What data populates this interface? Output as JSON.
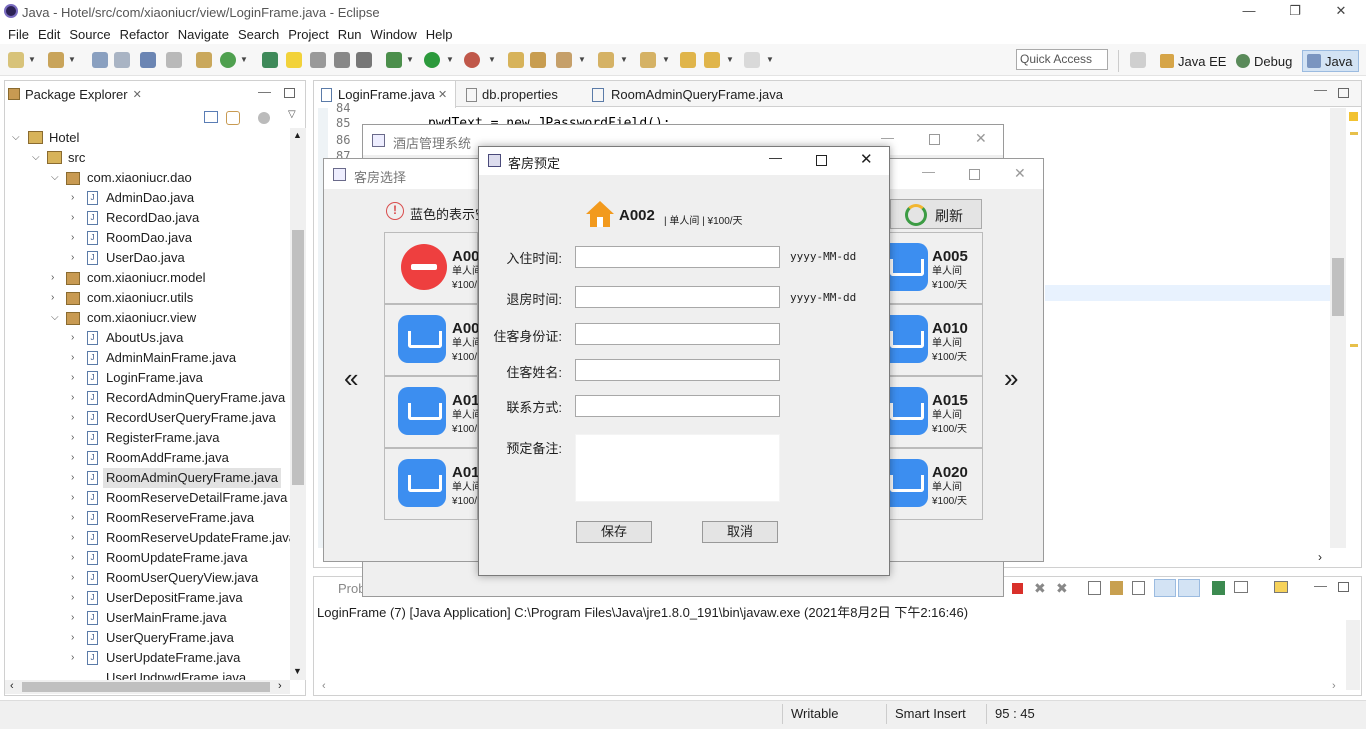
{
  "window": {
    "title": "Java - Hotel/src/com/xiaoniucr/view/LoginFrame.java - Eclipse"
  },
  "menu": [
    "File",
    "Edit",
    "Source",
    "Refactor",
    "Navigate",
    "Search",
    "Project",
    "Run",
    "Window",
    "Help"
  ],
  "quick_access": "Quick Access",
  "perspectives": [
    "Java EE",
    "Debug",
    "Java"
  ],
  "package_explorer": {
    "tab": "Package Explorer",
    "project": "Hotel",
    "src": "src",
    "pkg_dao": "com.xiaoniucr.dao",
    "dao_files": [
      "AdminDao.java",
      "RecordDao.java",
      "RoomDao.java",
      "UserDao.java"
    ],
    "pkg_model": "com.xiaoniucr.model",
    "pkg_utils": "com.xiaoniucr.utils",
    "pkg_view": "com.xiaoniucr.view",
    "view_files": [
      "AboutUs.java",
      "AdminMainFrame.java",
      "LoginFrame.java",
      "RecordAdminQueryFrame.java",
      "RecordUserQueryFrame.java",
      "RegisterFrame.java",
      "RoomAddFrame.java",
      "RoomAdminQueryFrame.java",
      "RoomReserveDetailFrame.java",
      "RoomReserveFrame.java",
      "RoomReserveUpdateFrame.java",
      "RoomUpdateFrame.java",
      "RoomUserQueryView.java",
      "UserDepositFrame.java",
      "UserMainFrame.java",
      "UserQueryFrame.java",
      "UserUpdateFrame.java",
      "UserUpdpwdFrame.java"
    ]
  },
  "editor": {
    "tabs": [
      "LoginFrame.java",
      "db.properties",
      "RoomAdminQueryFrame.java"
    ],
    "line_numbers": [
      "84",
      "85",
      "86",
      "87"
    ],
    "code_line": "pwdText = new JPasswordField();"
  },
  "console": {
    "tab": "Prob",
    "line": "LoginFrame (7) [Java Application] C:\\Program Files\\Java\\jre1.8.0_191\\bin\\javaw.exe (2021年8月2日 下午2:16:46)"
  },
  "status": {
    "writable": "Writable",
    "insert": "Smart Insert",
    "pos": "95 : 45"
  },
  "win_hotel": {
    "title": "酒店管理系统"
  },
  "win_rooms": {
    "title": "客房选择",
    "hint": "蓝色的表示空",
    "refresh": "刷新",
    "prev": "«",
    "next": "»",
    "left": [
      {
        "name": "A00",
        "type": "单人间",
        "price": "¥100/"
      },
      {
        "name": "A00",
        "type": "单人间",
        "price": "¥100/"
      },
      {
        "name": "A01",
        "type": "单人间",
        "price": "¥100/"
      },
      {
        "name": "A01",
        "type": "单人间",
        "price": "¥100/"
      }
    ],
    "right": [
      {
        "name": "A005",
        "type": "单人间",
        "price": "¥100/天"
      },
      {
        "name": "A010",
        "type": "单人间",
        "price": "¥100/天"
      },
      {
        "name": "A015",
        "type": "单人间",
        "price": "¥100/天"
      },
      {
        "name": "A020",
        "type": "单人间",
        "price": "¥100/天"
      }
    ]
  },
  "dialog": {
    "title": "客房预定",
    "room": "A002",
    "room_info": "| 单人间 | ¥100/天",
    "labels": {
      "checkin": "入住时间:",
      "checkout": "退房时间:",
      "idcard": "住客身份证:",
      "name": "住客姓名:",
      "contact": "联系方式:",
      "remark": "预定备注:"
    },
    "date_hint": "yyyy-MM-dd",
    "save": "保存",
    "cancel": "取消"
  }
}
